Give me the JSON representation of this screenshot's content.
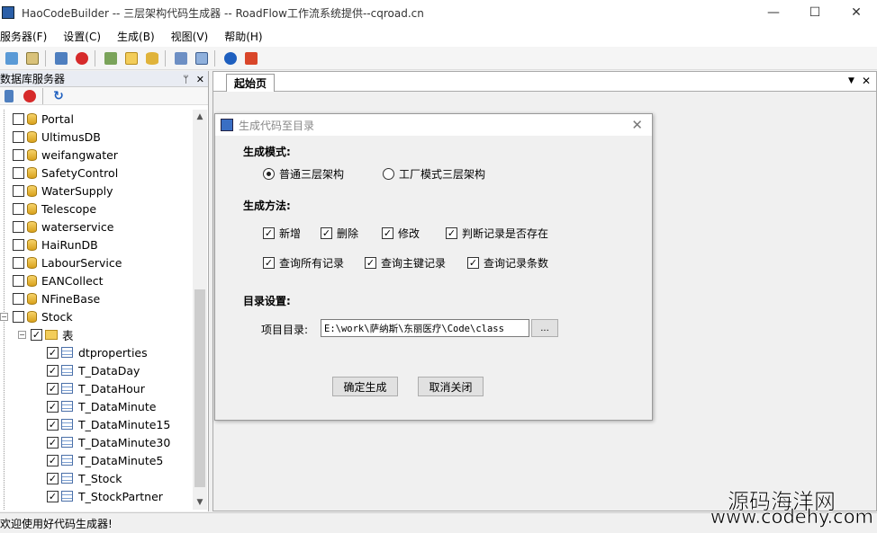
{
  "window": {
    "title": "HaoCodeBuilder -- 三层架构代码生成器 -- RoadFlow工作流系统提供--cqroad.cn",
    "minimize": "—",
    "maximize": "☐",
    "close": "✕"
  },
  "menu": [
    "服务器(F)",
    "设置(C)",
    "生成(B)",
    "视图(V)",
    "帮助(H)"
  ],
  "toolbar_icons": [
    "add-server-icon",
    "copy-icon",
    "connect-icon",
    "stop-icon",
    "tools-icon",
    "folder-icon",
    "database-icon",
    "export-icon",
    "window-icon",
    "info-icon",
    "exit-icon"
  ],
  "left_panel": {
    "title": "数据库服务器",
    "pin": "ᛘ",
    "close": "✕",
    "tree": [
      {
        "label": "Portal",
        "kind": "db",
        "checked": false
      },
      {
        "label": "UltimusDB",
        "kind": "db",
        "checked": false
      },
      {
        "label": "weifangwater",
        "kind": "db",
        "checked": false
      },
      {
        "label": "SafetyControl",
        "kind": "db",
        "checked": false
      },
      {
        "label": "WaterSupply",
        "kind": "db",
        "checked": false
      },
      {
        "label": "Telescope",
        "kind": "db",
        "checked": false
      },
      {
        "label": "waterservice",
        "kind": "db",
        "checked": false
      },
      {
        "label": "HaiRunDB",
        "kind": "db",
        "checked": false
      },
      {
        "label": "LabourService",
        "kind": "db",
        "checked": false
      },
      {
        "label": "EANCollect",
        "kind": "db",
        "checked": false
      },
      {
        "label": "NFineBase",
        "kind": "db",
        "checked": false
      },
      {
        "label": "Stock",
        "kind": "db",
        "checked": false,
        "expanded": true
      },
      {
        "label": "表",
        "kind": "folder",
        "checked": true,
        "expanded": true
      },
      {
        "label": "dtproperties",
        "kind": "table",
        "checked": true
      },
      {
        "label": "T_DataDay",
        "kind": "table",
        "checked": true
      },
      {
        "label": "T_DataHour",
        "kind": "table",
        "checked": true
      },
      {
        "label": "T_DataMinute",
        "kind": "table",
        "checked": true
      },
      {
        "label": "T_DataMinute15",
        "kind": "table",
        "checked": true
      },
      {
        "label": "T_DataMinute30",
        "kind": "table",
        "checked": true
      },
      {
        "label": "T_DataMinute5",
        "kind": "table",
        "checked": true
      },
      {
        "label": "T_Stock",
        "kind": "table",
        "checked": true
      },
      {
        "label": "T_StockPartner",
        "kind": "table",
        "checked": true
      }
    ]
  },
  "doc": {
    "tab_label": "起始页",
    "dropdown": "▼",
    "close": "✕"
  },
  "dialog": {
    "title": "生成代码至目录",
    "close": "✕",
    "mode_heading": "生成模式:",
    "mode_options": [
      {
        "label": "普通三层架构",
        "selected": true
      },
      {
        "label": "工厂模式三层架构",
        "selected": false
      }
    ],
    "method_heading": "生成方法:",
    "methods_row1": [
      {
        "label": "新增",
        "checked": true
      },
      {
        "label": "删除",
        "checked": true
      },
      {
        "label": "修改",
        "checked": true
      },
      {
        "label": "判断记录是否存在",
        "checked": true
      }
    ],
    "methods_row2": [
      {
        "label": "查询所有记录",
        "checked": true
      },
      {
        "label": "查询主键记录",
        "checked": true
      },
      {
        "label": "查询记录条数",
        "checked": true
      }
    ],
    "dir_heading": "目录设置:",
    "project_dir_label": "项目目录:",
    "project_dir_value": "E:\\work\\萨纳斯\\东丽医疗\\Code\\class",
    "browse_label": "...",
    "ok_label": "确定生成",
    "cancel_label": "取消关闭"
  },
  "status": {
    "text": "欢迎使用好代码生成器!"
  },
  "watermark": {
    "line1": "源码海洋网",
    "line2": "www.codehy.com"
  },
  "colors": {
    "accent": "#2b5fa8",
    "panel_header": "#e9ecf3"
  }
}
